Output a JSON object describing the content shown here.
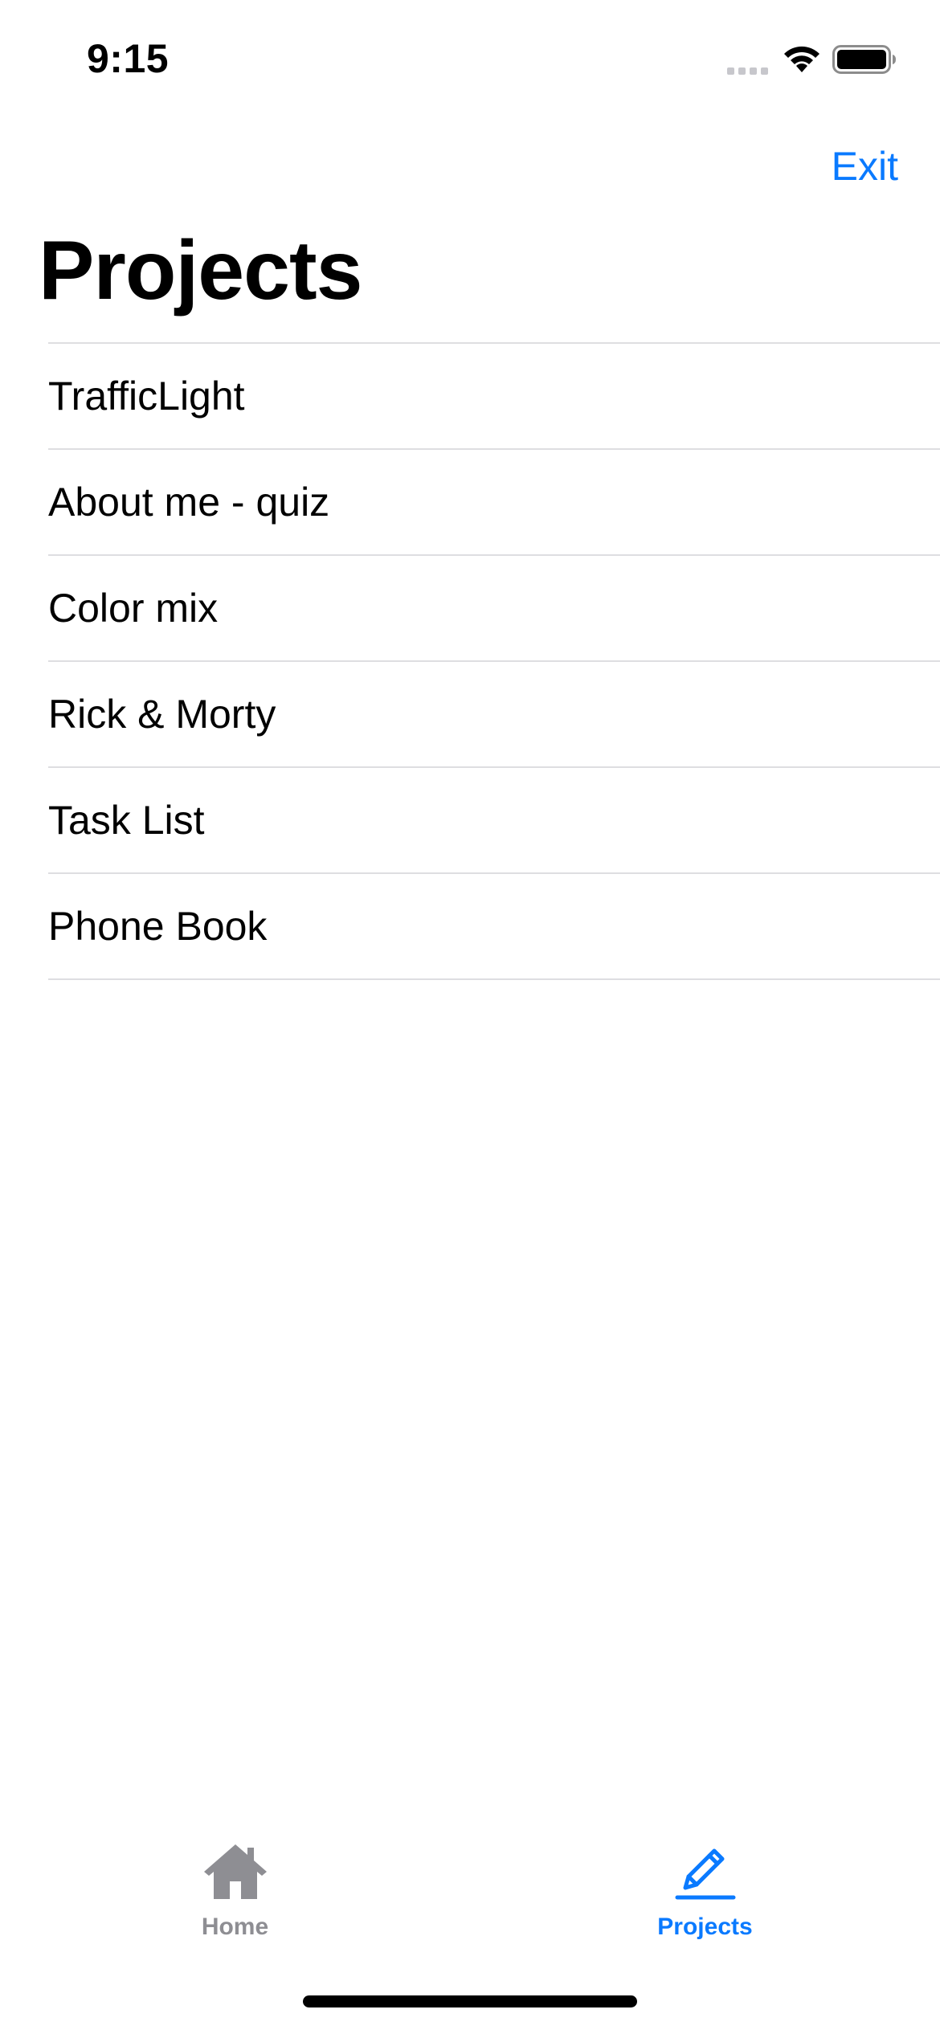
{
  "status_bar": {
    "time": "9:15"
  },
  "nav": {
    "exit_label": "Exit",
    "title": "Projects"
  },
  "projects": [
    {
      "label": "TrafficLight"
    },
    {
      "label": "About me - quiz"
    },
    {
      "label": "Color mix"
    },
    {
      "label": "Rick & Morty"
    },
    {
      "label": "Task List"
    },
    {
      "label": "Phone Book"
    }
  ],
  "tab_bar": {
    "tabs": [
      {
        "label": "Home",
        "icon": "house-icon",
        "selected": false
      },
      {
        "label": "Projects",
        "icon": "pencil-icon",
        "selected": true
      }
    ]
  },
  "colors": {
    "accent": "#0a7aff",
    "inactive_tab": "#8e8e93",
    "separator": "#dedee1"
  }
}
